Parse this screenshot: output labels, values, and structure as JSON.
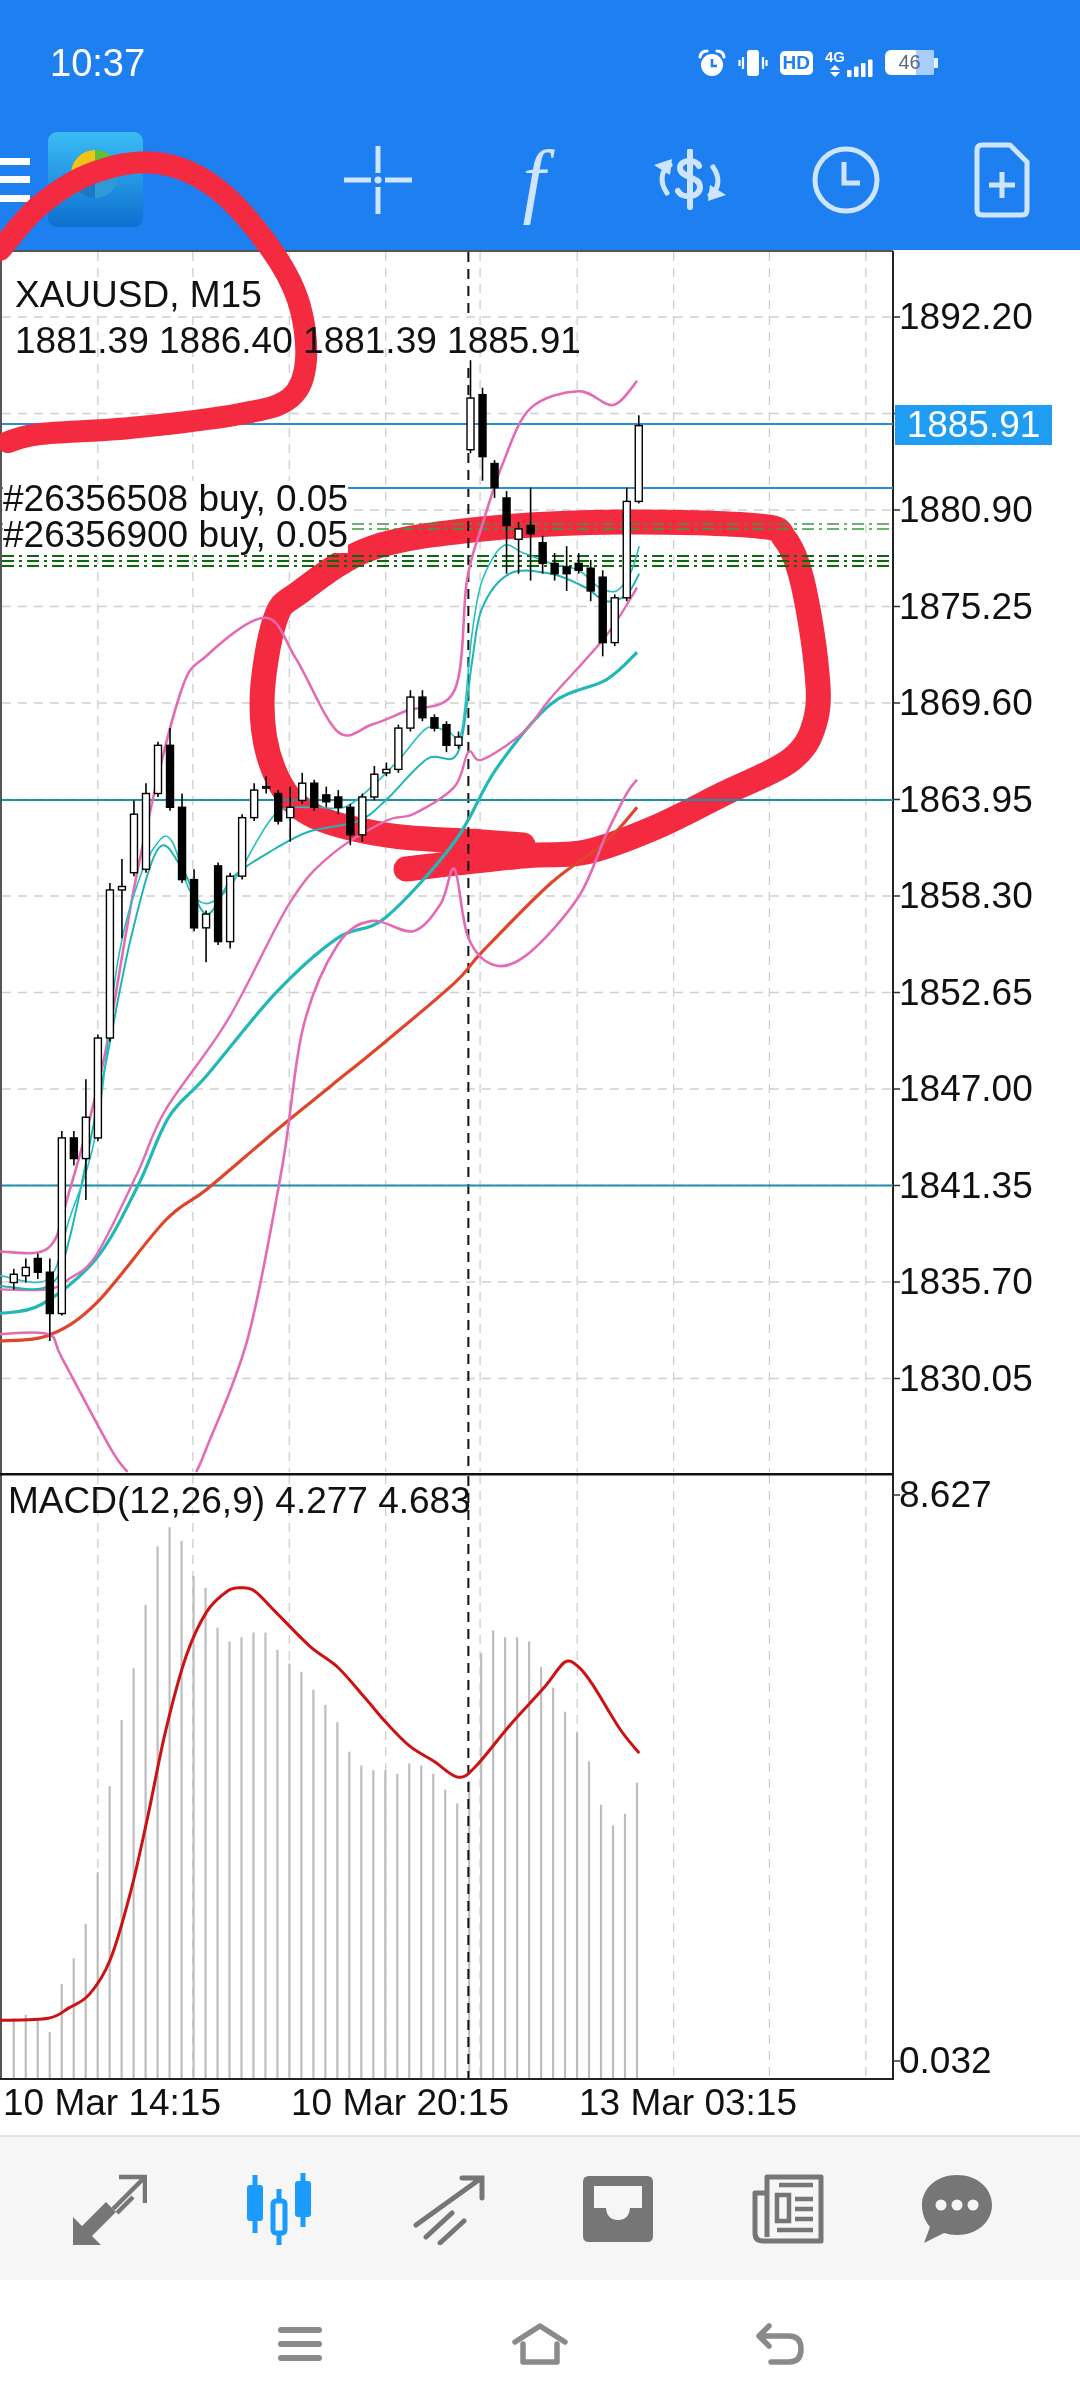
{
  "status_bar": {
    "time": "10:37",
    "icons": [
      {
        "kind": "alarm"
      },
      {
        "kind": "vibrate"
      },
      {
        "kind": "badge",
        "label": "HD"
      },
      {
        "kind": "network",
        "label": "4G"
      },
      {
        "kind": "battery",
        "label": "46"
      }
    ]
  },
  "toolbar": [
    {
      "kind": "menu"
    },
    {
      "kind": "logo"
    },
    {
      "kind": "crosshair"
    },
    {
      "kind": "function",
      "label": "f"
    },
    {
      "kind": "trade"
    },
    {
      "kind": "clock"
    },
    {
      "kind": "new_document"
    }
  ],
  "chart": {
    "title": "XAUUSD, M15",
    "ohlc": "1881.39 1886.40 1881.39 1885.91",
    "orders": [
      "#26356508 buy, 0.05",
      "#26356900 buy, 0.05"
    ],
    "current_price": "1885.91",
    "price_axis": [
      "1892.20",
      "1880.90",
      "1875.25",
      "1869.60",
      "1863.95",
      "1858.30",
      "1852.65",
      "1847.00",
      "1841.35",
      "1835.70",
      "1830.05"
    ],
    "time_axis": [
      "10 Mar 14:15",
      "10 Mar 20:15",
      "13 Mar 03:15"
    ]
  },
  "macd": {
    "title": "MACD(12,26,9) 4.277 4.683",
    "axis": [
      "8.627",
      "0.032"
    ]
  },
  "bottom_nav": [
    {
      "kind": "trade",
      "selected": false
    },
    {
      "kind": "chart",
      "selected": true
    },
    {
      "kind": "history",
      "selected": false
    },
    {
      "kind": "mailbox",
      "selected": false
    },
    {
      "kind": "news",
      "selected": false
    },
    {
      "kind": "chat",
      "selected": false
    }
  ],
  "system_nav": [
    {
      "kind": "menu"
    },
    {
      "kind": "home"
    },
    {
      "kind": "back"
    }
  ]
}
